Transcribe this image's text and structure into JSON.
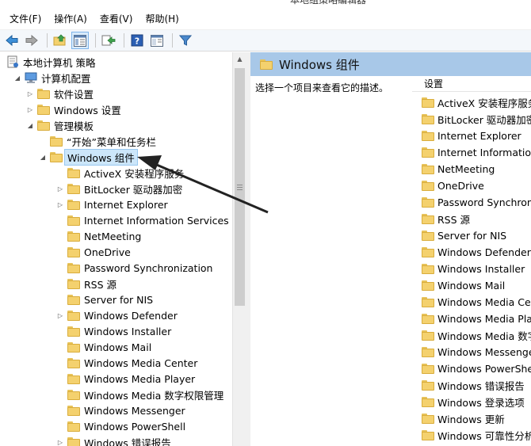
{
  "window": {
    "title": "本地组策略编辑器"
  },
  "menu": [
    "文件(F)",
    "操作(A)",
    "查看(V)",
    "帮助(H)"
  ],
  "toolbar": [
    "back-icon",
    "forward-icon",
    "up-folder-icon",
    "show-hide-tree-icon",
    "export-list-icon",
    "help-icon",
    "properties-icon",
    "filter-icon"
  ],
  "tree": [
    {
      "label": "本地计算机 策略",
      "level": 0,
      "expander": "none",
      "icon": "policy-icon"
    },
    {
      "label": "计算机配置",
      "level": 1,
      "expander": "expanded",
      "icon": "computer-icon"
    },
    {
      "label": "软件设置",
      "level": 2,
      "expander": "collapsed",
      "icon": "folder-icon"
    },
    {
      "label": "Windows 设置",
      "level": 2,
      "expander": "collapsed",
      "icon": "folder-icon"
    },
    {
      "label": "管理模板",
      "level": 2,
      "expander": "expanded",
      "icon": "folder-icon"
    },
    {
      "label": "“开始”菜单和任务栏",
      "level": 3,
      "expander": "none",
      "icon": "folder-icon"
    },
    {
      "label": "Windows 组件",
      "level": 3,
      "expander": "expanded",
      "icon": "folder-icon",
      "selected": true
    },
    {
      "label": "ActiveX 安装程序服务",
      "level": 4,
      "expander": "none",
      "icon": "folder-icon"
    },
    {
      "label": "BitLocker 驱动器加密",
      "level": 4,
      "expander": "collapsed",
      "icon": "folder-icon"
    },
    {
      "label": "Internet Explorer",
      "level": 4,
      "expander": "collapsed",
      "icon": "folder-icon"
    },
    {
      "label": "Internet Information Services",
      "level": 4,
      "expander": "none",
      "icon": "folder-icon"
    },
    {
      "label": "NetMeeting",
      "level": 4,
      "expander": "none",
      "icon": "folder-icon"
    },
    {
      "label": "OneDrive",
      "level": 4,
      "expander": "none",
      "icon": "folder-icon"
    },
    {
      "label": "Password Synchronization",
      "level": 4,
      "expander": "none",
      "icon": "folder-icon"
    },
    {
      "label": "RSS 源",
      "level": 4,
      "expander": "none",
      "icon": "folder-icon"
    },
    {
      "label": "Server for NIS",
      "level": 4,
      "expander": "none",
      "icon": "folder-icon"
    },
    {
      "label": "Windows Defender",
      "level": 4,
      "expander": "collapsed",
      "icon": "folder-icon"
    },
    {
      "label": "Windows Installer",
      "level": 4,
      "expander": "none",
      "icon": "folder-icon"
    },
    {
      "label": "Windows Mail",
      "level": 4,
      "expander": "none",
      "icon": "folder-icon"
    },
    {
      "label": "Windows Media Center",
      "level": 4,
      "expander": "none",
      "icon": "folder-icon"
    },
    {
      "label": "Windows Media Player",
      "level": 4,
      "expander": "none",
      "icon": "folder-icon"
    },
    {
      "label": "Windows Media 数字权限管理",
      "level": 4,
      "expander": "none",
      "icon": "folder-icon"
    },
    {
      "label": "Windows Messenger",
      "level": 4,
      "expander": "none",
      "icon": "folder-icon"
    },
    {
      "label": "Windows PowerShell",
      "level": 4,
      "expander": "none",
      "icon": "folder-icon"
    },
    {
      "label": "Windows 错误报告",
      "level": 4,
      "expander": "collapsed",
      "icon": "folder-icon"
    }
  ],
  "right": {
    "title": "Windows 组件",
    "description": "选择一个项目来查看它的描述。",
    "column_header": "设置",
    "items": [
      "ActiveX 安装程序服务",
      "BitLocker 驱动器加密",
      "Internet Explorer",
      "Internet Information",
      "NetMeeting",
      "OneDrive",
      "Password Synchroniz",
      "RSS 源",
      "Server for NIS",
      "Windows Defender",
      "Windows Installer",
      "Windows Mail",
      "Windows Media Cer",
      "Windows Media Play",
      "Windows Media 数字",
      "Windows Messenger",
      "Windows PowerShel",
      "Windows 错误报告",
      "Windows 登录选项",
      "Windows 更新",
      "Windows 可靠性分析"
    ]
  },
  "colors": {
    "header_bg": "#a8c8e8",
    "selection_bg": "#cce6fa",
    "annotation_arrow": "#222222"
  }
}
